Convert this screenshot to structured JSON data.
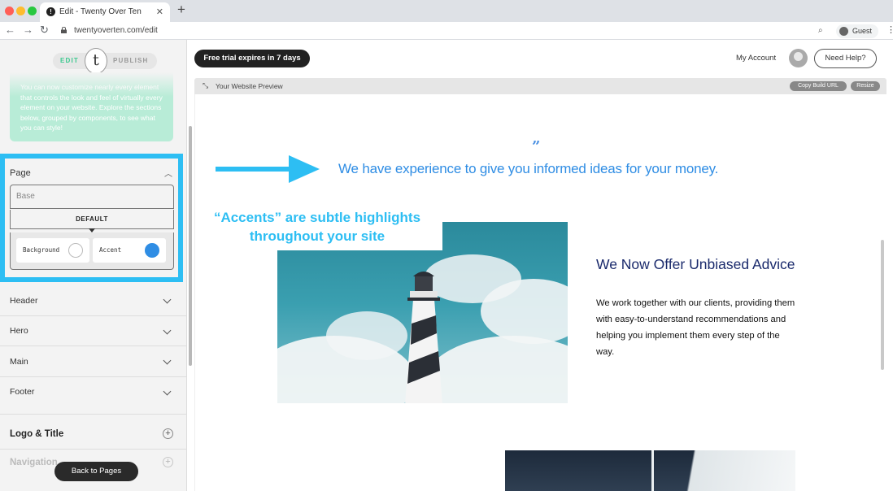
{
  "browser": {
    "tab_title": "Edit - Twenty Over Ten",
    "url": "twentyoverten.com/edit",
    "profile": "Guest",
    "traffic_lights": [
      "#ff5f57",
      "#febc2e",
      "#28c840"
    ]
  },
  "sidebar": {
    "edit_label": "EDIT",
    "publish_label": "PUBLISH",
    "logo_letter": "t",
    "intro_text": "You can now customize nearly every element that controls the look and feel of virtually every element on your website. Explore the sections below, grouped by components, to see what you can style!",
    "page_panel": {
      "title": "Page",
      "base_placeholder": "Base",
      "default_label": "DEFAULT",
      "swatches": [
        {
          "label": "Background",
          "color": "#ffffff"
        },
        {
          "label": "Accent",
          "color": "#2f8de4"
        }
      ]
    },
    "sections": [
      "Header",
      "Hero",
      "Main",
      "Footer"
    ],
    "logo_title": "Logo & Title",
    "navigation": "Navigation",
    "back_button": "Back to Pages"
  },
  "topbar": {
    "trial_badge": "Free trial expires in 7 days",
    "my_account": "My Account",
    "need_help": "Need Help?"
  },
  "preview": {
    "bar_title": "Your Website Preview",
    "copy_build_url": "Copy Build URL",
    "resize": "Resize",
    "quote_mark": "”",
    "quote": "We have experience to give you informed ideas for your money.",
    "callout_line1": "“Accents” are subtle highlights",
    "callout_line2": "throughout your site",
    "offer_title": "We Now Offer Unbiased Advice",
    "offer_body": "We work together with our clients, providing them with easy-to-understand recommendations and helping you implement them every step of the way.",
    "accent_color": "#2dbef3"
  }
}
